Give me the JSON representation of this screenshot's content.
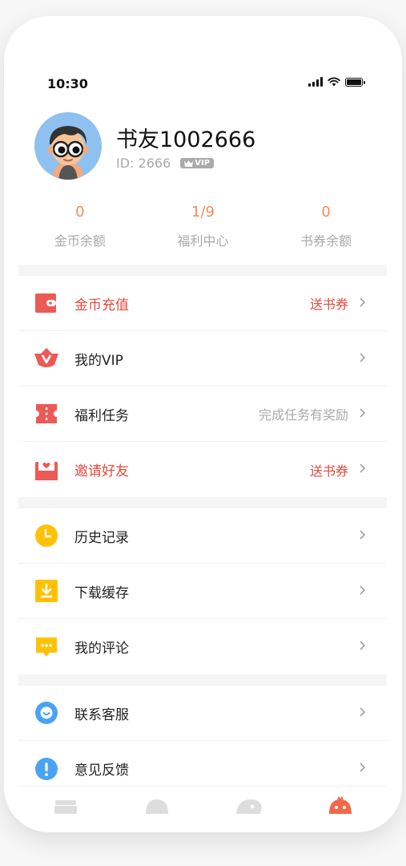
{
  "status_bar": {
    "time": "10:30"
  },
  "profile": {
    "username": "书友1002666",
    "id_text": "ID: 2666",
    "vip_badge": "VIP"
  },
  "stats": [
    {
      "value": "0",
      "label": "金币余额"
    },
    {
      "value": "1/9",
      "label": "福利中心"
    },
    {
      "value": "0",
      "label": "书券余额"
    }
  ],
  "menu_group_1": [
    {
      "label": "金币充值",
      "extra": "送书券",
      "icon": "wallet-icon"
    },
    {
      "label": "我的VIP",
      "extra": "",
      "icon": "vip-crown-icon"
    },
    {
      "label": "福利任务",
      "extra": "完成任务有奖励",
      "icon": "ticket-icon"
    },
    {
      "label": "邀请好友",
      "extra": "送书券",
      "icon": "invite-envelope-icon"
    }
  ],
  "menu_group_2": [
    {
      "label": "历史记录",
      "icon": "clock-icon"
    },
    {
      "label": "下载缓存",
      "icon": "download-icon"
    },
    {
      "label": "我的评论",
      "icon": "comment-icon"
    }
  ],
  "menu_group_3": [
    {
      "label": "联系客服",
      "icon": "customer-service-icon"
    },
    {
      "label": "意见反馈",
      "icon": "feedback-icon"
    }
  ],
  "tab_bar": {
    "tabs": [
      {
        "icon": "bookshelf-tab-icon",
        "active": false
      },
      {
        "icon": "bookstore-tab-icon",
        "active": false
      },
      {
        "icon": "discover-tab-icon",
        "active": false
      },
      {
        "icon": "mine-tab-icon",
        "active": true
      }
    ]
  },
  "colors": {
    "accent_red": "#e44a3e",
    "stat_orange": "#f08c5a",
    "icon_yellow": "#ffc107",
    "icon_blue": "#4aa3f0"
  }
}
